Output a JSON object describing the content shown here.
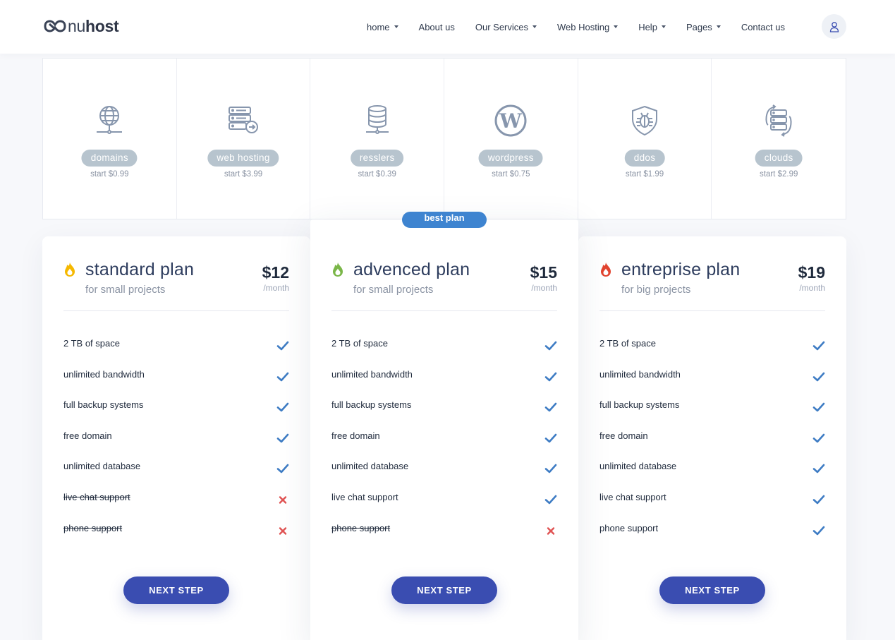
{
  "brand": {
    "logo_light": "nu",
    "logo_bold": "host",
    "accent": "#3a4db1"
  },
  "nav": {
    "items": [
      {
        "label": "home",
        "caret": true
      },
      {
        "label": "About us",
        "caret": false
      },
      {
        "label": "Our Services",
        "caret": true
      },
      {
        "label": "Web Hosting",
        "caret": true
      },
      {
        "label": "Help",
        "caret": true
      },
      {
        "label": "Pages",
        "caret": true
      },
      {
        "label": "Contact us",
        "caret": false
      }
    ],
    "user_icon": "user-icon"
  },
  "services": [
    {
      "icon": "globe-network-icon",
      "label": "domains",
      "price": "start $0.99"
    },
    {
      "icon": "server-arrow-icon",
      "label": "web hosting",
      "price": "start $3.99"
    },
    {
      "icon": "database-network-icon",
      "label": "resslers",
      "price": "start $0.39"
    },
    {
      "icon": "wordpress-icon",
      "label": "wordpress",
      "price": "start $0.75"
    },
    {
      "icon": "shield-bug-icon",
      "label": "ddos",
      "price": "start $1.99"
    },
    {
      "icon": "cloud-servers-icon",
      "label": "clouds",
      "price": "start $2.99"
    }
  ],
  "best_plan_label": "best plan",
  "plans": [
    {
      "name": "standard plan",
      "subtitle": "for small projects",
      "price": "$12",
      "period": "/month",
      "flame_color": "#f5b800",
      "features": [
        {
          "text": "2 TB of space",
          "included": true
        },
        {
          "text": "unlimited bandwidth",
          "included": true
        },
        {
          "text": "full backup systems",
          "included": true
        },
        {
          "text": "free domain",
          "included": true
        },
        {
          "text": "unlimited database",
          "included": true
        },
        {
          "text": "live chat support",
          "included": false
        },
        {
          "text": "phone support",
          "included": false
        }
      ],
      "button": "NEXT STEP"
    },
    {
      "name": "advenced plan",
      "subtitle": "for small projects",
      "price": "$15",
      "period": "/month",
      "flame_color": "#7ab648",
      "features": [
        {
          "text": "2 TB of space",
          "included": true
        },
        {
          "text": "unlimited bandwidth",
          "included": true
        },
        {
          "text": "full backup systems",
          "included": true
        },
        {
          "text": "free domain",
          "included": true
        },
        {
          "text": "unlimited database",
          "included": true
        },
        {
          "text": "live chat support",
          "included": true
        },
        {
          "text": "phone support",
          "included": false
        }
      ],
      "button": "NEXT STEP"
    },
    {
      "name": "entreprise plan",
      "subtitle": "for big projects",
      "price": "$19",
      "period": "/month",
      "flame_color": "#e2442f",
      "features": [
        {
          "text": "2 TB of space",
          "included": true
        },
        {
          "text": "unlimited bandwidth",
          "included": true
        },
        {
          "text": "full backup systems",
          "included": true
        },
        {
          "text": "free domain",
          "included": true
        },
        {
          "text": "unlimited database",
          "included": true
        },
        {
          "text": "live chat support",
          "included": true
        },
        {
          "text": "phone support",
          "included": true
        }
      ],
      "button": "NEXT STEP"
    }
  ],
  "colors": {
    "check": "#3e7cc4",
    "cross": "#e05252",
    "pill": "#b7c4ce"
  }
}
